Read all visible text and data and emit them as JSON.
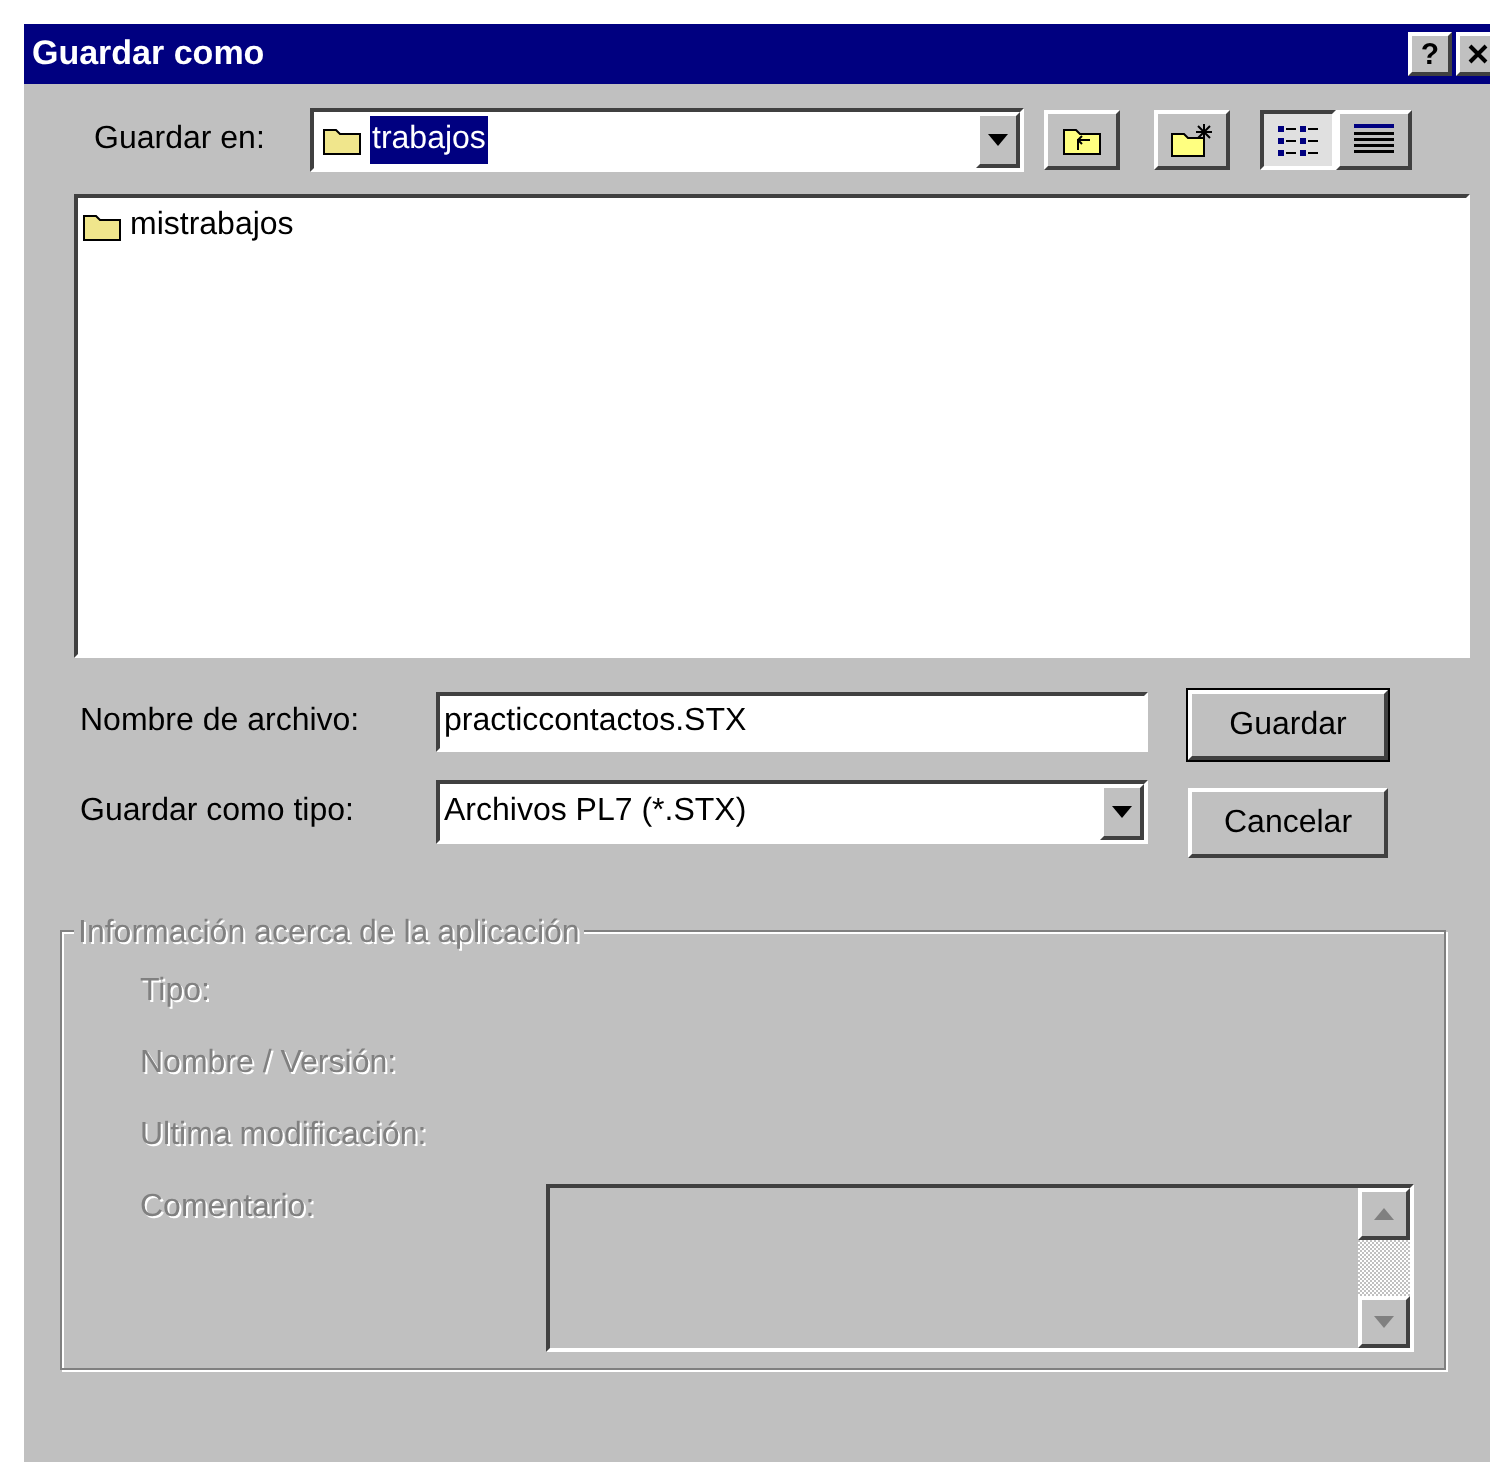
{
  "window": {
    "title": "Guardar como",
    "help": "?"
  },
  "save_in": {
    "label": "Guardar en:",
    "value": "trabajos"
  },
  "files": [
    {
      "name": "mistrabajos",
      "kind": "folder"
    }
  ],
  "view_buttons": [
    {
      "kind": "list",
      "selected": true
    },
    {
      "kind": "details",
      "selected": false
    }
  ],
  "file_name": {
    "label": "Nombre de archivo:",
    "value": "practiccontactos.STX"
  },
  "file_type": {
    "label": "Guardar como tipo:",
    "value": "Archivos PL7 (*.STX)"
  },
  "buttons": [
    "Guardar",
    "Cancelar"
  ],
  "info_group": {
    "title": "Información acerca de la aplicación",
    "disabled": true,
    "fields": [
      "Tipo:",
      "Nombre / Versión:",
      "Ultima modificación:"
    ],
    "comment_label": "Comentario:"
  }
}
